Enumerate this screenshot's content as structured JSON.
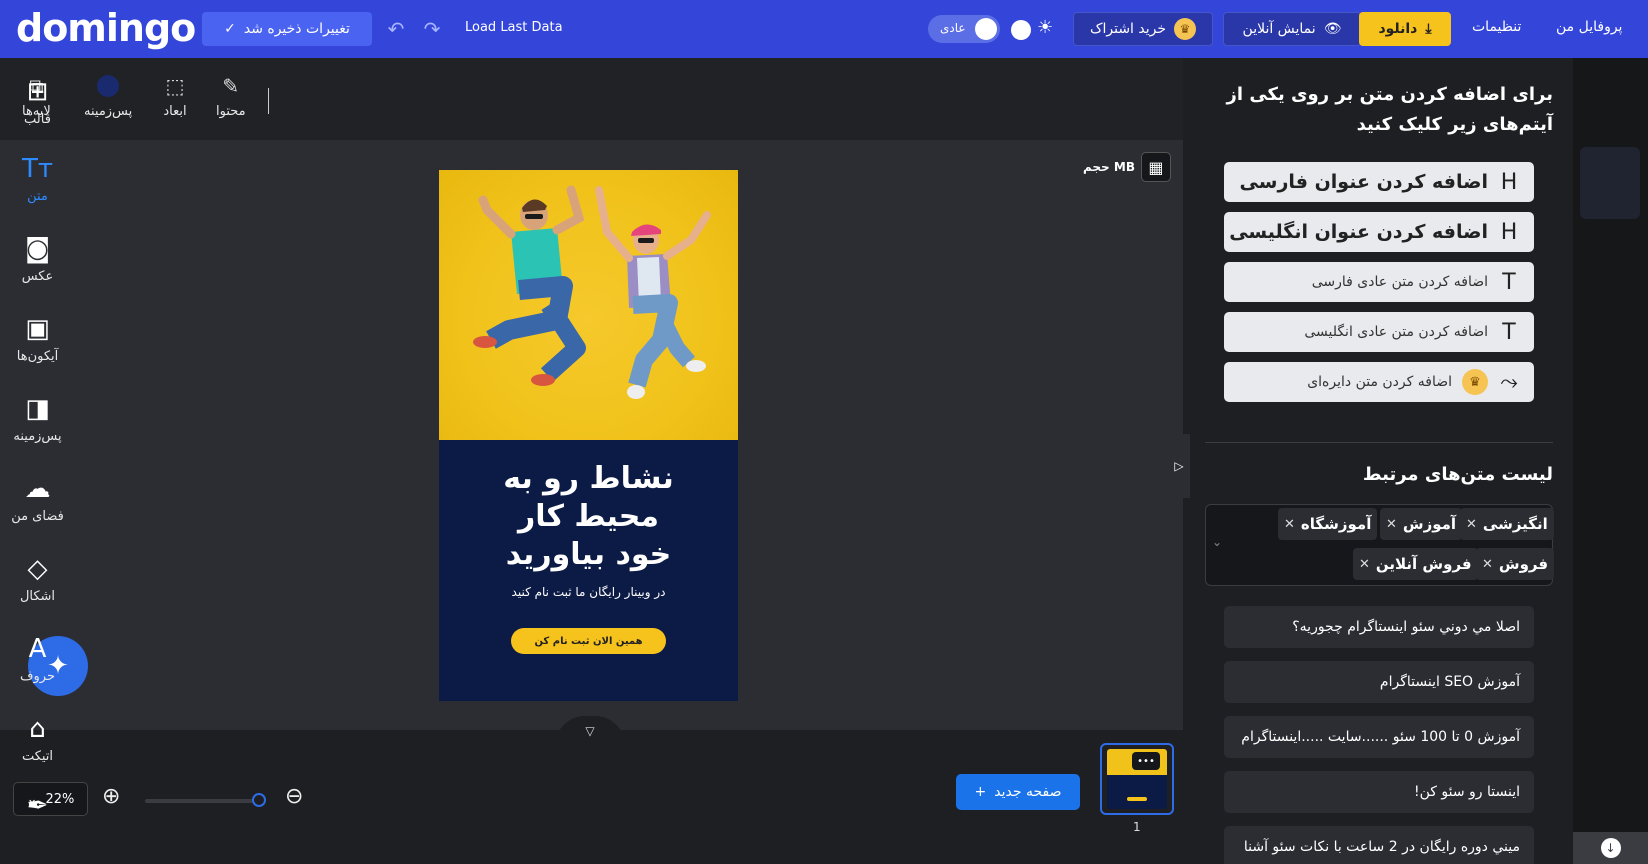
{
  "app": {
    "logo": "domingo"
  },
  "topbar": {
    "saved_label": "تغییرات ذخیره شد",
    "load_last": "Load Last Data",
    "mode_label": "عادی",
    "subscribe_label": "خرید اشتراک",
    "online_label": "نمایش آنلاین",
    "download_label": "دانلود",
    "settings_label": "تنظیمات",
    "profile_label": "پروفایل من"
  },
  "toolbar": {
    "layers": "لایه‌ها",
    "background": "پس‌زمینه",
    "dimensions": "ابعاد",
    "content": "محتوا"
  },
  "canvas": {
    "size_label": "حجم MB",
    "design_title": "نشاط رو به محیط کار خود بیاورید",
    "design_sub": "در وبینار رایگان ما ثبت نام کنید",
    "design_cta": "همین الان ثبت نام کن"
  },
  "bottom": {
    "zoom": "22%",
    "new_page": "صفحه جدید",
    "page_number": "1"
  },
  "panel": {
    "intro": "برای اضافه کردن متن بر روی یکی از آیتم‌های زیر کلیک کنید",
    "add_buttons": [
      "اضافه کردن عنوان فارسی",
      "اضافه کردن عنوان انگلیسی",
      "اضافه کردن متن عادی فارسی",
      "اضافه کردن متن عادی انگلیسی",
      "اضافه کردن متن دایره‌ای"
    ],
    "related_title": "لیست متن‌های مرتبط",
    "tags": [
      "انگیزشی",
      "آموزش",
      "آموزشگاه",
      "فروش",
      "فروش آنلاین"
    ],
    "related": [
      "اصلا مي دوني سئو اينستاگرام چجوريه؟",
      "آموزش SEO اینستاگرام",
      "آموزش 0 تا 100 سئو ......سایت .....اینستاگرام",
      "اینستا رو سئو کن!",
      "میني دوره رایگان در 2 ساعت با نکات سئو آشنا"
    ]
  },
  "rnav": [
    "قالب",
    "متن",
    "عکس",
    "آیکون‌ها",
    "پس‌زمینه",
    "فضای من",
    "اشکال",
    "حروف",
    "اتیکت"
  ],
  "colors": {
    "topbar": "#3346d9",
    "accent": "#f6c21c",
    "primary": "#1a73e8",
    "design_bg": "#0c1b45"
  }
}
